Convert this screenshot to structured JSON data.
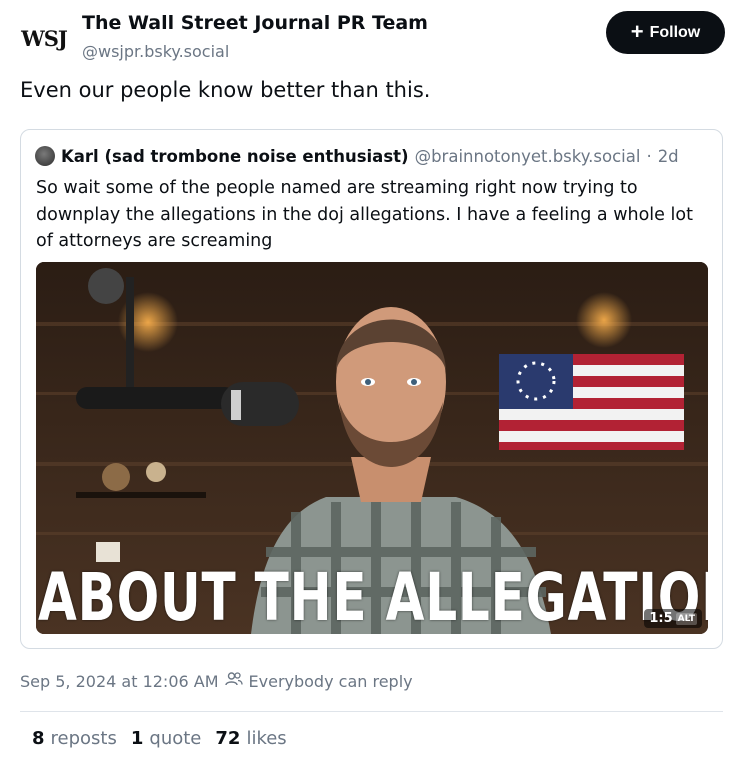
{
  "author": {
    "avatar_text": "WSJ",
    "name": "The Wall Street Journal PR Team",
    "handle": "@wsjpr.bsky.social"
  },
  "follow_label": "Follow",
  "post_text": "Even our people know better than this.",
  "quoted": {
    "name": "Karl (sad trombone noise enthusiast)",
    "handle": "@brainnotonyet.bsky.social",
    "separator": "·",
    "age": "2d",
    "text": "So wait some of the people named are streaming right now trying to downplay the allegations in the doj allegations. I have a feeling a whole lot of attorneys are screaming",
    "video": {
      "caption": "ABOUT THE ALLEGATIONS",
      "duration": "1:5",
      "alt_badge": "ALT"
    }
  },
  "meta": {
    "timestamp": "Sep 5, 2024 at 12:06 AM",
    "reply_setting": "Everybody can reply"
  },
  "stats": {
    "reposts_count": "8",
    "reposts_label": "reposts",
    "quotes_count": "1",
    "quotes_label": "quote",
    "likes_count": "72",
    "likes_label": "likes"
  },
  "colors": {
    "text": "#0b0f14",
    "muted": "#6b7684",
    "border": "#d4dbe2",
    "button_bg": "#0b0f14"
  },
  "icons": [
    "plus-icon",
    "people-icon"
  ]
}
